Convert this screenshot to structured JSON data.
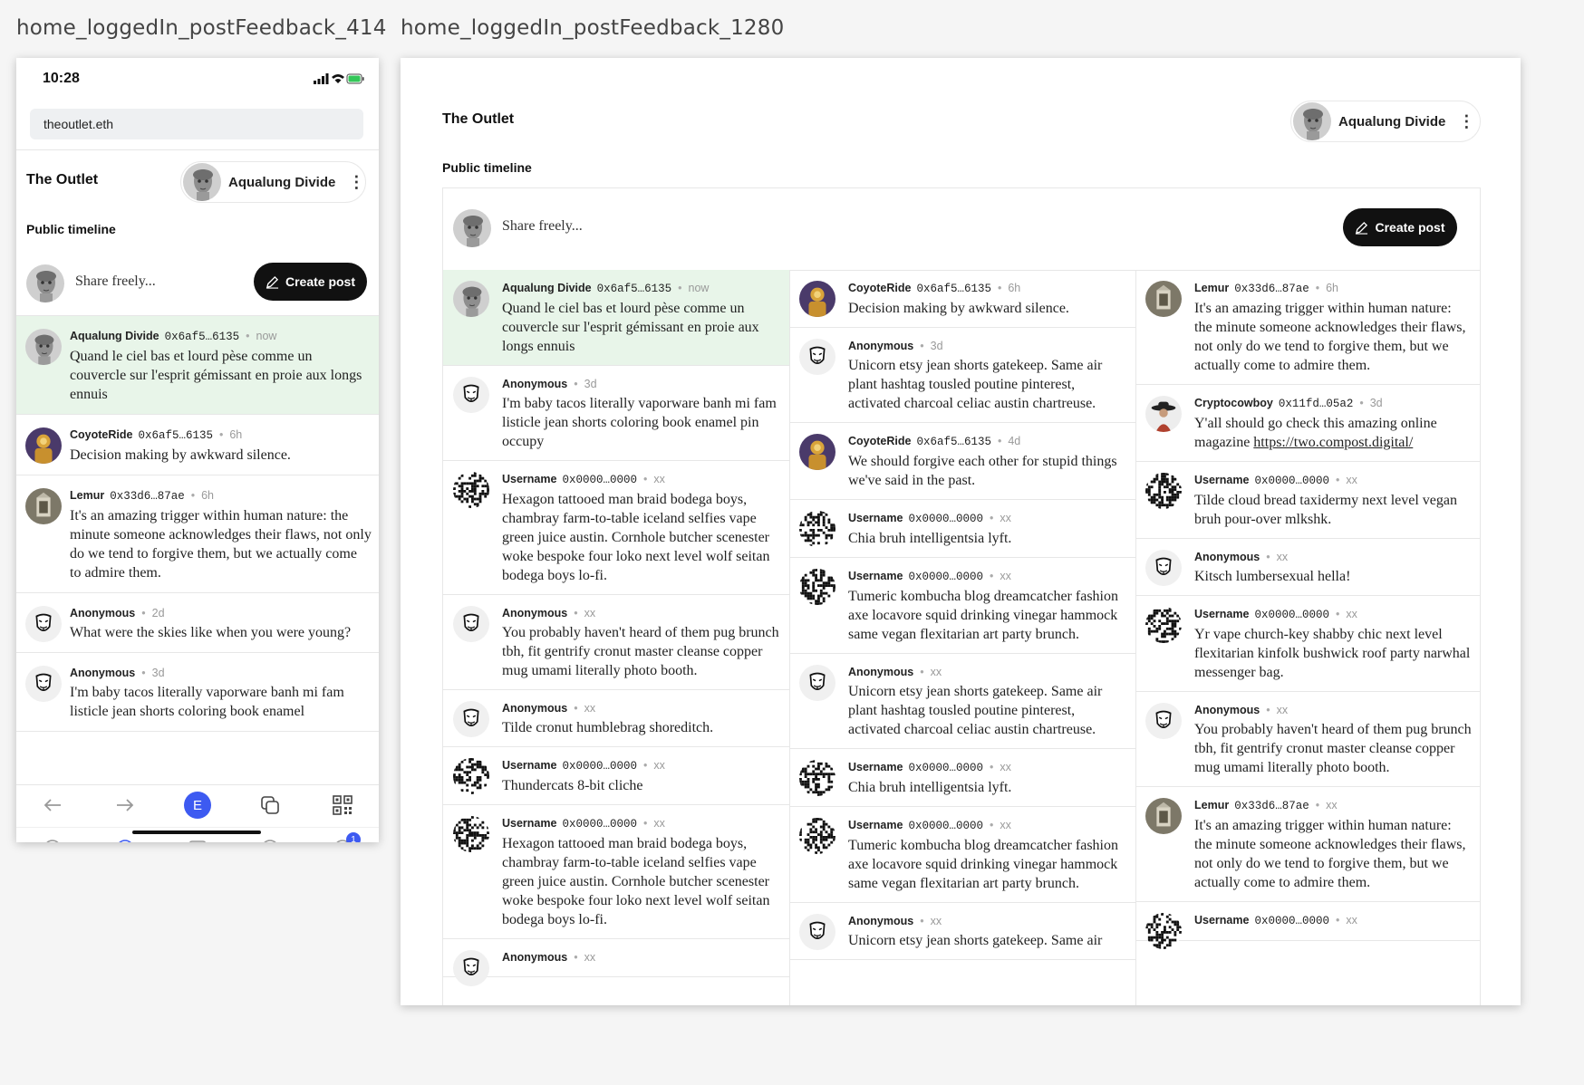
{
  "frames": {
    "mobile_label": "home_loggedIn_postFeedback_414",
    "desktop_label": "home_loggedIn_postFeedback_1280"
  },
  "mobile": {
    "status_time": "10:28",
    "url": "theoutlet.eth",
    "bottom_nav_letter": "E",
    "notification_count": "1"
  },
  "app": {
    "title": "The Outlet",
    "user_name": "Aqualung Divide",
    "menu_glyph": "⋮",
    "section_title": "Public timeline",
    "share_placeholder": "Share freely...",
    "create_post_label": "Create post"
  },
  "colors": {
    "highlight": "#e8f5e9",
    "accent_blue": "#3d5af1",
    "button_dark": "#111111"
  },
  "mobile_posts": [
    {
      "name": "Aqualung Divide",
      "addr": "0x6af5…6135",
      "time": "now",
      "avatar": "statue",
      "text": "Quand le ciel bas et lourd pèse comme un couvercle sur l'esprit gémissant en proie aux longs ennuis",
      "highlight": true
    },
    {
      "name": "CoyoteRide",
      "addr": "0x6af5…6135",
      "time": "6h",
      "avatar": "coyote",
      "text": "Decision making by awkward silence."
    },
    {
      "name": "Lemur",
      "addr": "0x33d6…87ae",
      "time": "6h",
      "avatar": "lemur",
      "text": "It's an amazing trigger within human nature: the minute someone acknowledges their flaws, not only do we tend to forgive them, but we actually come to admire them."
    },
    {
      "name": "Anonymous",
      "addr": "",
      "time": "2d",
      "avatar": "anon",
      "text": "What were the skies like when you were young?"
    },
    {
      "name": "Anonymous",
      "addr": "",
      "time": "3d",
      "avatar": "anon",
      "text": "I'm baby tacos literally vaporware banh mi fam listicle jean shorts coloring book enamel"
    }
  ],
  "desktop_columns": [
    [
      {
        "name": "Aqualung Divide",
        "addr": "0x6af5…6135",
        "time": "now",
        "avatar": "statue",
        "text": "Quand le ciel bas et lourd pèse comme un couvercle sur l'esprit gémissant en proie aux longs ennuis",
        "highlight": true
      },
      {
        "name": "Anonymous",
        "addr": "",
        "time": "3d",
        "avatar": "anon",
        "text": "I'm baby tacos literally vaporware banh mi fam listicle jean shorts coloring book enamel pin occupy"
      },
      {
        "name": "Username",
        "addr": "0x0000…0000",
        "time": "xx",
        "avatar": "noise",
        "text": "Hexagon tattooed man braid bodega boys, chambray farm-to-table iceland selfies vape green juice austin. Cornhole butcher scenester woke bespoke four loko next level wolf seitan bodega boys lo-fi."
      },
      {
        "name": "Anonymous",
        "addr": "",
        "time": "xx",
        "avatar": "anon",
        "text": "You probably haven't heard of them pug brunch tbh, fit gentrify cronut master cleanse copper mug umami literally photo booth."
      },
      {
        "name": "Anonymous",
        "addr": "",
        "time": "xx",
        "avatar": "anon",
        "text": "Tilde cronut humblebrag shoreditch."
      },
      {
        "name": "Username",
        "addr": "0x0000…0000",
        "time": "xx",
        "avatar": "noise",
        "text": "Thundercats 8-bit cliche"
      },
      {
        "name": "Username",
        "addr": "0x0000…0000",
        "time": "xx",
        "avatar": "noise",
        "text": "Hexagon tattooed man braid bodega boys, chambray farm-to-table iceland selfies vape green juice austin. Cornhole butcher scenester woke bespoke four loko next level wolf seitan bodega boys lo-fi."
      },
      {
        "name": "Anonymous",
        "addr": "",
        "time": "xx",
        "avatar": "anon",
        "text": ""
      }
    ],
    [
      {
        "name": "CoyoteRide",
        "addr": "0x6af5…6135",
        "time": "6h",
        "avatar": "coyote",
        "text": "Decision making by awkward silence."
      },
      {
        "name": "Anonymous",
        "addr": "",
        "time": "3d",
        "avatar": "anon",
        "text": "Unicorn etsy jean shorts gatekeep. Same air plant hashtag tousled poutine pinterest, activated charcoal celiac austin chartreuse."
      },
      {
        "name": "CoyoteRide",
        "addr": "0x6af5…6135",
        "time": "4d",
        "avatar": "coyote",
        "text": "We should forgive each other for stupid things we've said in the past."
      },
      {
        "name": "Username",
        "addr": "0x0000…0000",
        "time": "xx",
        "avatar": "noise",
        "text": "Chia bruh intelligentsia lyft."
      },
      {
        "name": "Username",
        "addr": "0x0000…0000",
        "time": "xx",
        "avatar": "noise",
        "text": "Tumeric kombucha blog dreamcatcher fashion axe locavore squid drinking vinegar hammock same vegan flexitarian art party brunch."
      },
      {
        "name": "Anonymous",
        "addr": "",
        "time": "xx",
        "avatar": "anon",
        "text": "Unicorn etsy jean shorts gatekeep. Same air plant hashtag tousled poutine pinterest, activated charcoal celiac austin chartreuse."
      },
      {
        "name": "Username",
        "addr": "0x0000…0000",
        "time": "xx",
        "avatar": "noise",
        "text": "Chia bruh intelligentsia lyft."
      },
      {
        "name": "Username",
        "addr": "0x0000…0000",
        "time": "xx",
        "avatar": "noise",
        "text": "Tumeric kombucha blog dreamcatcher fashion axe locavore squid drinking vinegar hammock same vegan flexitarian art party brunch."
      },
      {
        "name": "Anonymous",
        "addr": "",
        "time": "xx",
        "avatar": "anon",
        "text": "Unicorn etsy jean shorts gatekeep. Same air"
      }
    ],
    [
      {
        "name": "Lemur",
        "addr": "0x33d6…87ae",
        "time": "6h",
        "avatar": "lemur",
        "text": "It's an amazing trigger within human nature: the minute someone acknowledges their flaws, not only do we tend to forgive them, but we actually come to admire them."
      },
      {
        "name": "Cryptocowboy",
        "addr": "0x11fd…05a2",
        "time": "3d",
        "avatar": "cowboy",
        "text": "Y'all should go check this amazing online magazine ",
        "link": "https://two.compost.digital/"
      },
      {
        "name": "Username",
        "addr": "0x0000…0000",
        "time": "xx",
        "avatar": "noise",
        "text": "Tilde cloud bread taxidermy next level vegan bruh pour-over mlkshk."
      },
      {
        "name": "Anonymous",
        "addr": "",
        "time": "xx",
        "avatar": "anon",
        "text": "Kitsch lumbersexual hella!"
      },
      {
        "name": "Username",
        "addr": "0x0000…0000",
        "time": "xx",
        "avatar": "noise",
        "text": "Yr vape church-key shabby chic next level flexitarian kinfolk bushwick roof party narwhal messenger bag."
      },
      {
        "name": "Anonymous",
        "addr": "",
        "time": "xx",
        "avatar": "anon",
        "text": "You probably haven't heard of them pug brunch tbh, fit gentrify cronut master cleanse copper mug umami literally photo booth."
      },
      {
        "name": "Lemur",
        "addr": "0x33d6…87ae",
        "time": "xx",
        "avatar": "lemur",
        "text": "It's an amazing trigger within human nature: the minute someone acknowledges their flaws, not only do we tend to forgive them, but we actually come to admire them."
      },
      {
        "name": "Username",
        "addr": "0x0000…0000",
        "time": "xx",
        "avatar": "noise",
        "text": ""
      }
    ]
  ]
}
